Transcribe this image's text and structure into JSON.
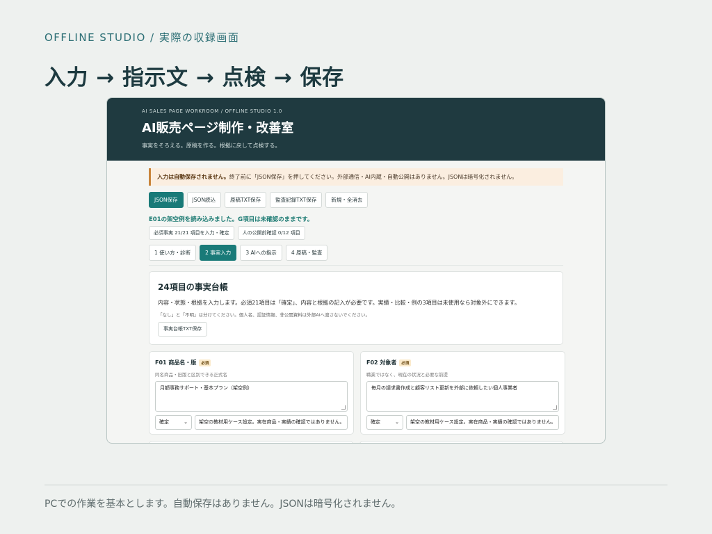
{
  "slide": {
    "kicker": "OFFLINE STUDIO / 実際の収録画面",
    "headline": "入力 → 指示文 → 点検 → 保存",
    "footer": "PCでの作業を基本とします。自動保存はありません。JSONは暗号化されません。"
  },
  "app": {
    "kicker": "AI SALES PAGE WORKROOM / OFFLINE STUDIO 1.0",
    "title": "AI販売ページ制作・改善室",
    "subtitle": "事実をそろえる。原稿を作る。根拠に戻して点検する。",
    "notice": {
      "bold": "入力は自動保存されません。",
      "text": "終了前に「JSON保存」を押してください。外部通信・AI内蔵・自動公開はありません。JSONは暗号化されません。"
    },
    "actions": [
      "JSON保存",
      "JSON読込",
      "原稿TXT保存",
      "監査記録TXT保存",
      "新規・全消去"
    ],
    "status": "E01の架空例を読み込みました。G項目は未確認のままです。",
    "chips": [
      "必須事実 21/21 項目を入力・確定",
      "人の公開前確認 0/12 項目"
    ],
    "tabs": [
      "1 使い方・診断",
      "2 事実入力",
      "3 AIへの指示",
      "4 原稿・監査"
    ],
    "active_tab": "2 事実入力",
    "ledger": {
      "title": "24項目の事実台帳",
      "desc": "内容・状態・根拠を入力します。必須21項目は「確定」、内容と根拠の記入が必要です。実績・比較・例の3項目は未使用なら対象外にできます。",
      "note": "「なし」と「不明」は分けてください。個人名、認証情報、非公開資料は外部AIへ渡さないでください。",
      "button": "事実台帳TXT保存"
    },
    "fields": [
      {
        "label": "F01 商品名・版",
        "badge": "必須",
        "help": "同名商品・旧版と区別できる正式名",
        "value": "月額事務サポート・基本プラン（架空例）",
        "state": "確定",
        "basis": "架空の教材用ケース設定。実在商品・実績の確認ではありません。"
      },
      {
        "label": "F02 対象者",
        "badge": "必須",
        "help": "職業ではなく、現在の状況と必要な前提",
        "value": "毎月の請求書作成と顧客リスト更新を外部に依頼したい個人事業者",
        "state": "確定",
        "basis": "架空の教材用ケース設定。実在商品・実績の確認ではありません。"
      }
    ]
  }
}
